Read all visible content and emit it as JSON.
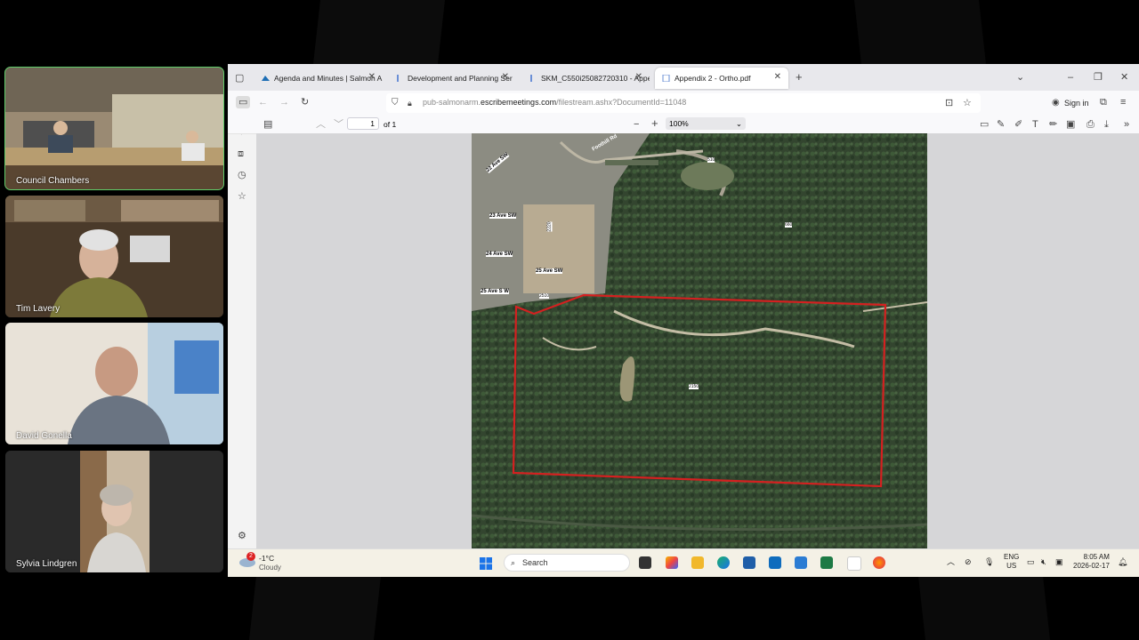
{
  "participants": [
    {
      "name": "Council Chambers"
    },
    {
      "name": "Tim Lavery"
    },
    {
      "name": "David Gonella"
    },
    {
      "name": "Sylvia Lindgren"
    }
  ],
  "browser": {
    "tabs": [
      {
        "label": "Agenda and Minutes | Salmon A"
      },
      {
        "label": "Development and Planning Ser"
      },
      {
        "label": "SKM_C550i25082720310 - Appe"
      },
      {
        "label": "Appendix 2 - Ortho.pdf"
      }
    ],
    "url_host": "pub-salmonarm.",
    "url_domain": "escribemeetings.com",
    "url_path": "/filestream.ashx?DocumentId=11048",
    "sign_in": "Sign in",
    "pdf": {
      "page": "1",
      "of": "of 1",
      "zoom": "100%"
    }
  },
  "map": {
    "labels": [
      {
        "text": "Foothill Rd"
      },
      {
        "text": "22 Ave SW"
      },
      {
        "text": "23 Ave SW"
      },
      {
        "text": "24 Ave SW"
      },
      {
        "text": "25 Ave SW"
      },
      {
        "text": "25 Ave S W"
      },
      {
        "text": "2510"
      },
      {
        "text": "2150"
      },
      {
        "text": "660"
      },
      {
        "text": "510"
      },
      {
        "text": "2220"
      }
    ]
  },
  "taskbar": {
    "weather_temp": "-1°C",
    "weather_desc": "Cloudy",
    "weather_badge": "2",
    "search": "Search",
    "lang1": "ENG",
    "lang2": "US",
    "time": "8:05 AM",
    "date": "2026-02-17"
  },
  "colors": {
    "active_tile": "#5fce6a",
    "boundary": "#d42020"
  }
}
